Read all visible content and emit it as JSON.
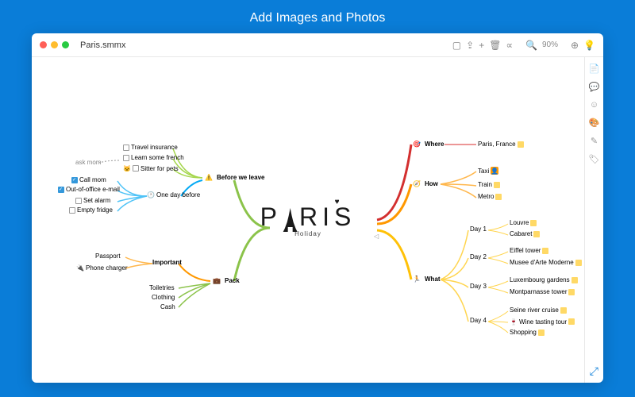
{
  "header": "Add Images and Photos",
  "filename": "Paris.smmx",
  "zoom": "90%",
  "center": {
    "title": "PARIS",
    "subtitle": "Holiday"
  },
  "toolbar_icons": [
    "image-icon",
    "share-icon",
    "plus-icon",
    "trash-icon",
    "link-icon",
    "search-icon",
    "globe-icon",
    "bulb-icon"
  ],
  "right_icons": [
    "note-icon",
    "chat-icon",
    "smile-icon",
    "palette-icon",
    "pen-icon",
    "tag-icon"
  ],
  "left": {
    "before": {
      "label": "Before we leave",
      "items": [
        {
          "text": "Travel insurance",
          "cb": false
        },
        {
          "text": "Learn some french",
          "cb": false
        },
        {
          "text": "Sitter for pets",
          "cb": false,
          "icon": "🐱"
        }
      ],
      "askmom": "ask mom",
      "oneday": {
        "label": "One day before",
        "items": [
          {
            "text": "Call mom",
            "cb": true
          },
          {
            "text": "Out-of-office e-mail",
            "cb": true
          },
          {
            "text": "Set alarm",
            "cb": false
          },
          {
            "text": "Empty fridge",
            "cb": false
          }
        ]
      }
    },
    "pack": {
      "label": "Pack",
      "important": {
        "label": "Important",
        "items": [
          "Passport",
          "Phone charger"
        ]
      },
      "items": [
        "Toiletries",
        "Clothing",
        "Cash"
      ]
    }
  },
  "right": {
    "where": {
      "label": "Where",
      "val": "Paris, France"
    },
    "how": {
      "label": "How",
      "items": [
        "Taxi",
        "Train",
        "Metro"
      ]
    },
    "what": {
      "label": "What",
      "days": [
        {
          "d": "Day 1",
          "items": [
            "Louvre",
            "Cabaret"
          ]
        },
        {
          "d": "Day 2",
          "items": [
            "Eiffel tower",
            "Musee d'Arte Moderne"
          ]
        },
        {
          "d": "Day 3",
          "items": [
            "Luxembourg gardens",
            "Montparnasse tower"
          ]
        },
        {
          "d": "Day 4",
          "items": [
            "Seine river cruise",
            "Wine tasting tour",
            "Shopping"
          ]
        }
      ]
    }
  }
}
